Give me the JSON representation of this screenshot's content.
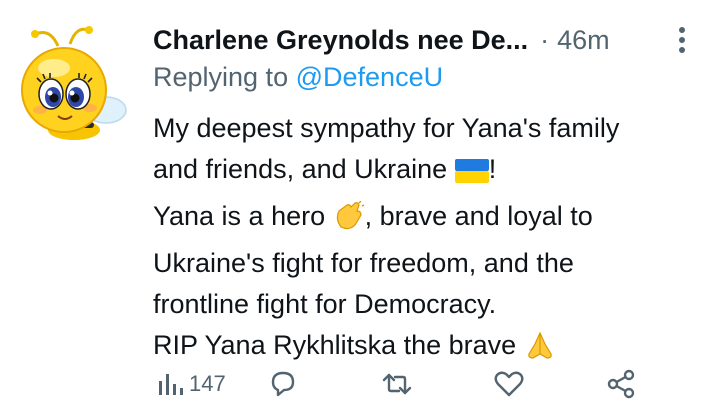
{
  "tweet": {
    "author_name": "Charlene Greynolds nee De...",
    "separator": "·",
    "time": "46m",
    "replying_prefix": "Replying to",
    "replying_handle": "@DefenceU",
    "lines": [
      {
        "text": "My deepest sympathy for Yana's family",
        "suffix": ""
      },
      {
        "text": "and friends, and Ukraine ",
        "emoji": "ukraine-flag",
        "suffix": "!"
      },
      {
        "text": "Yana is a hero ",
        "emoji": "clapping-hands",
        "suffix": ", brave and loyal to"
      },
      {
        "text": "Ukraine's fight for freedom, and the",
        "suffix": ""
      },
      {
        "text": "frontline fight for Democracy.",
        "suffix": ""
      },
      {
        "text": "RIP Yana Rykhlitska the brave ",
        "emoji": "folded-hands",
        "suffix": ""
      }
    ],
    "views_count": "147"
  },
  "icons": {
    "more": "more-vertical-icon",
    "views": "views-icon",
    "reply": "reply-icon",
    "retweet": "retweet-icon",
    "like": "like-icon",
    "share": "share-icon"
  },
  "colors": {
    "text": "#0f1419",
    "muted": "#536471",
    "accent": "#1d9bf0",
    "background": "#ffffff"
  }
}
